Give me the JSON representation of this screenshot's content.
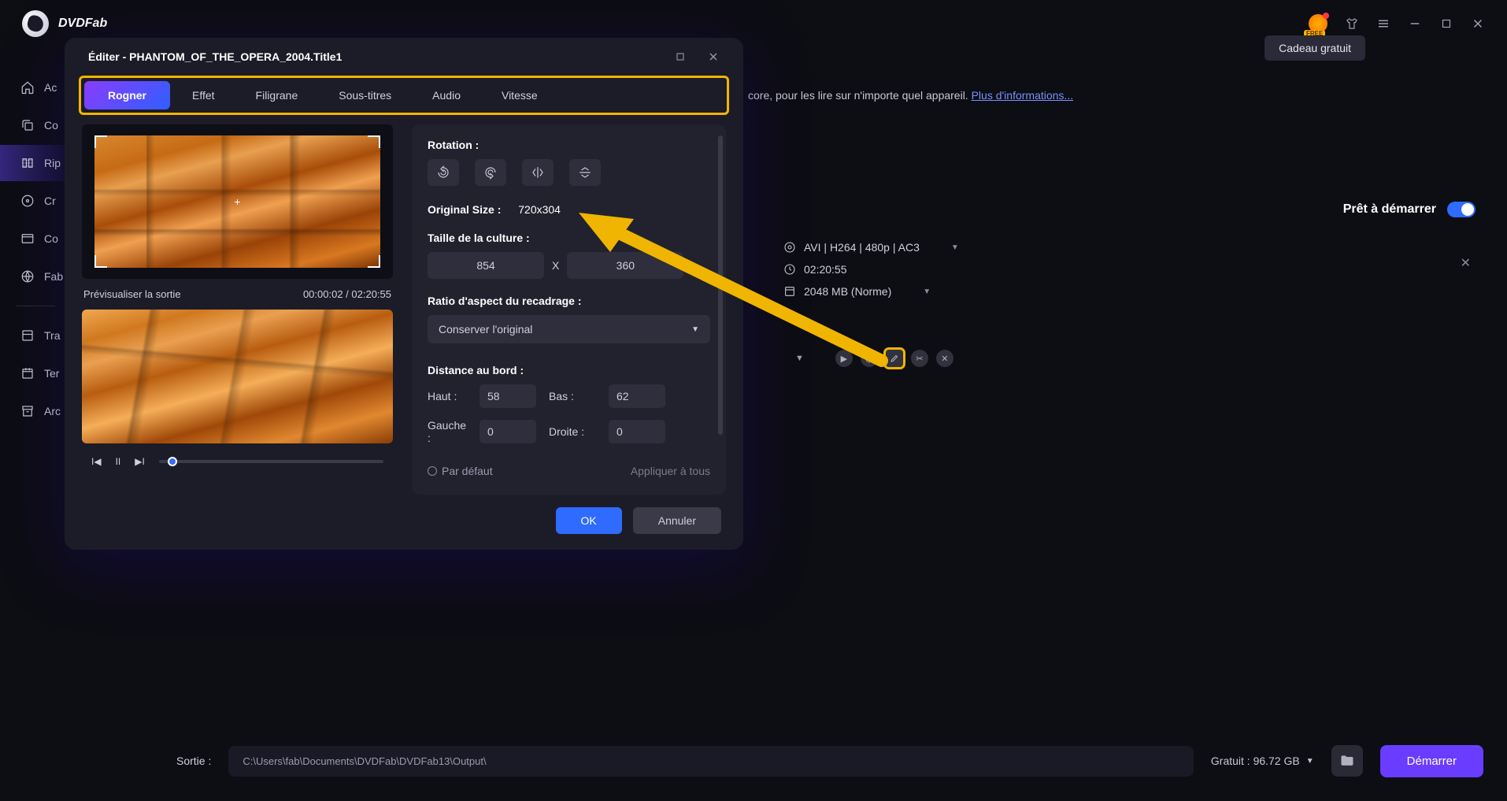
{
  "app": {
    "name": "DVDFab"
  },
  "window": {
    "gift_tooltip": "Cadeau gratuit",
    "gift_badge": "FREE"
  },
  "sidebar": {
    "items": [
      {
        "label": "Ac",
        "icon": "home"
      },
      {
        "label": "Co",
        "icon": "copy"
      },
      {
        "label": "Rip",
        "icon": "ripper",
        "active": true
      },
      {
        "label": "Cr",
        "icon": "creator"
      },
      {
        "label": "Co",
        "icon": "converter"
      },
      {
        "label": "Fab",
        "icon": "fab"
      }
    ],
    "secondary": [
      {
        "label": "Tra",
        "icon": "transfer"
      },
      {
        "label": "Ter",
        "icon": "calendar"
      },
      {
        "label": "Arc",
        "icon": "archive"
      }
    ]
  },
  "background": {
    "partial_text": "core, pour les lire sur n'importe quel appareil.",
    "more_link": "Plus d'informations...",
    "ready_label": "Prêt à démarrer",
    "meta": {
      "profile": "AVI | H264 | 480p | AC3",
      "duration": "02:20:55",
      "size": "2048 MB (Norme)"
    }
  },
  "bottom": {
    "label": "Sortie :",
    "path": "C:\\Users\\fab\\Documents\\DVDFab\\DVDFab13\\Output\\",
    "free_label": "Gratuit : 96.72 GB",
    "start": "Démarrer"
  },
  "editor": {
    "title": "Éditer - PHANTOM_OF_THE_OPERA_2004.Title1",
    "tabs": [
      "Rogner",
      "Effet",
      "Filigrane",
      "Sous-titres",
      "Audio",
      "Vitesse"
    ],
    "preview_label": "Prévisualiser la sortie",
    "timecode": "00:00:02 / 02:20:55",
    "rotation_label": "Rotation :",
    "original_size_label": "Original Size :",
    "original_size_value": "720x304",
    "crop_size_label": "Taille de la culture :",
    "crop_w": "854",
    "crop_h": "360",
    "crop_x": "X",
    "aspect_label": "Ratio d'aspect du recadrage :",
    "aspect_value": "Conserver l'original",
    "edge_label": "Distance au bord :",
    "edges": {
      "top_l": "Haut :",
      "top_v": "58",
      "bottom_l": "Bas :",
      "bottom_v": "62",
      "left_l": "Gauche :",
      "left_v": "0",
      "right_l": "Droite :",
      "right_v": "0"
    },
    "default_label": "Par défaut",
    "apply_all": "Appliquer à tous",
    "ok": "OK",
    "cancel": "Annuler"
  }
}
